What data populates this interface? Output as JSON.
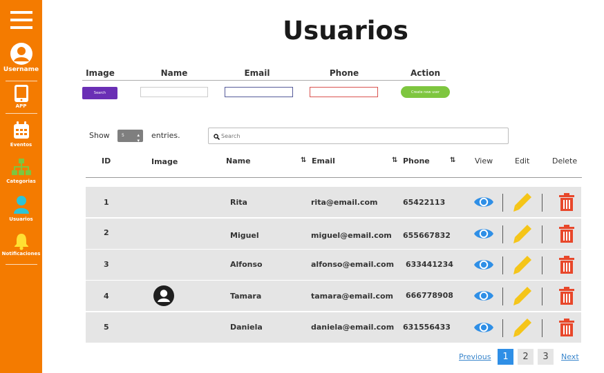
{
  "sidebar": {
    "username": "Username",
    "items": [
      {
        "label": "APP",
        "icon": "tablet-icon"
      },
      {
        "label": "Eventos",
        "icon": "calendar-icon"
      },
      {
        "label": "Categorias",
        "icon": "hierarchy-icon"
      },
      {
        "label": "Usuarios",
        "icon": "user-icon"
      },
      {
        "label": "Notificaciones",
        "icon": "bell-icon"
      }
    ]
  },
  "page": {
    "title": "Usuarios"
  },
  "filters": {
    "headers": [
      "Image",
      "Name",
      "Email",
      "Phone",
      "Action"
    ],
    "search_label": "Search",
    "create_label": "Create new user"
  },
  "table_controls": {
    "show_label": "Show",
    "entries_value": "5",
    "entries_label": "entries.",
    "search_placeholder": "Search"
  },
  "table": {
    "columns": [
      "ID",
      "Image",
      "Name",
      "Email",
      "Phone",
      "View",
      "Edit",
      "Delete"
    ],
    "rows": [
      {
        "id": "1",
        "name": "Rita",
        "email": "rita@email.com",
        "phone": "65422113",
        "has_avatar": false
      },
      {
        "id": "2",
        "name": "Miguel",
        "email": "miguel@email.com",
        "phone": "655667832",
        "has_avatar": false
      },
      {
        "id": "3",
        "name": "Alfonso",
        "email": "alfonso@email.com",
        "phone": "633441234",
        "has_avatar": false
      },
      {
        "id": "4",
        "name": "Tamara",
        "email": "tamara@email.com",
        "phone": "666778908",
        "has_avatar": true
      },
      {
        "id": "5",
        "name": "Daniela",
        "email": "daniela@email.com",
        "phone": "631556433",
        "has_avatar": false
      }
    ]
  },
  "pagination": {
    "previous": "Previous",
    "pages": [
      "1",
      "2",
      "3"
    ],
    "active": "1",
    "next": "Next"
  },
  "colors": {
    "sidebar": "#f47b00",
    "search_button": "#6a2fb5",
    "create_button": "#7ec63f",
    "view_icon": "#2f8fe6",
    "edit_icon": "#f5c518",
    "delete_icon": "#e8472a",
    "pagination_active": "#2f8fe6"
  }
}
